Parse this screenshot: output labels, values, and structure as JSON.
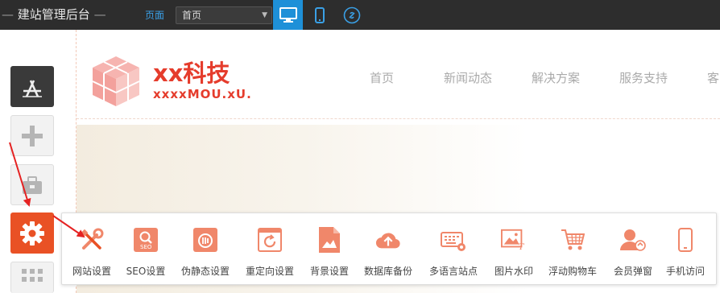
{
  "topbar": {
    "title": "建站管理后台",
    "page_label": "页面",
    "page_select": {
      "value": "首页"
    },
    "devices": [
      "desktop-icon",
      "mobile-icon",
      "link-icon"
    ]
  },
  "site": {
    "name": "xx科技",
    "subtitle": "xxxxMOU.xU.",
    "nav": [
      "首页",
      "新闻动态",
      "解决方案",
      "服务支持",
      "客"
    ]
  },
  "settings": {
    "items": [
      {
        "label": "网站设置",
        "icon": "tools-icon"
      },
      {
        "label": "SEO设置",
        "icon": "seo-icon"
      },
      {
        "label": "伪静态设置",
        "icon": "rewrite-icon"
      },
      {
        "label": "重定向设置",
        "icon": "redirect-icon"
      },
      {
        "label": "背景设置",
        "icon": "background-icon"
      },
      {
        "label": "数据库备份",
        "icon": "cloud-upload-icon"
      },
      {
        "label": "多语言站点",
        "icon": "keyboard-gear-icon"
      },
      {
        "label": "图片水印",
        "icon": "image-watermark-icon"
      },
      {
        "label": "浮动购物车",
        "icon": "cart-icon"
      },
      {
        "label": "会员弹窗",
        "icon": "member-icon"
      },
      {
        "label": "手机访问",
        "icon": "phone-icon"
      }
    ]
  },
  "colors": {
    "accent": "#e95125",
    "brand": "#e53c2c",
    "topbar": "#2d2d2d",
    "active_device": "#1e90d8",
    "icon": "#f0876a"
  }
}
